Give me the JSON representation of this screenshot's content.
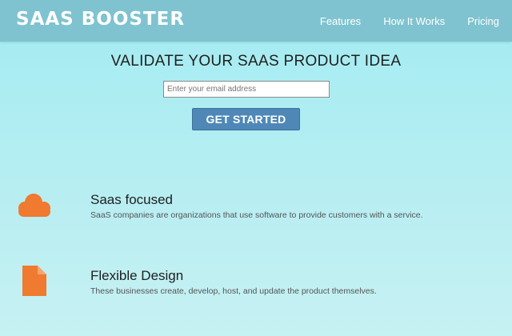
{
  "nav": {
    "logo": "SAAS BOOSTER",
    "links": [
      "Features",
      "How It Works",
      "Pricing"
    ]
  },
  "hero": {
    "title": "VALIDATE YOUR SAAS PRODUCT IDEA",
    "email_placeholder": "Enter your email address",
    "email_value": "",
    "cta_label": "GET STARTED"
  },
  "features": [
    {
      "icon": "cloud-icon",
      "title": "Saas focused",
      "description": "SaaS companies are organizations that use software to provide customers with a service."
    },
    {
      "icon": "file-icon",
      "title": "Flexible Design",
      "description": "These businesses create, develop, host, and update the product themselves."
    }
  ],
  "colors": {
    "navbar": "#7fc3d0",
    "accent_icon": "#ef7a30",
    "button": "#4f88b7"
  }
}
